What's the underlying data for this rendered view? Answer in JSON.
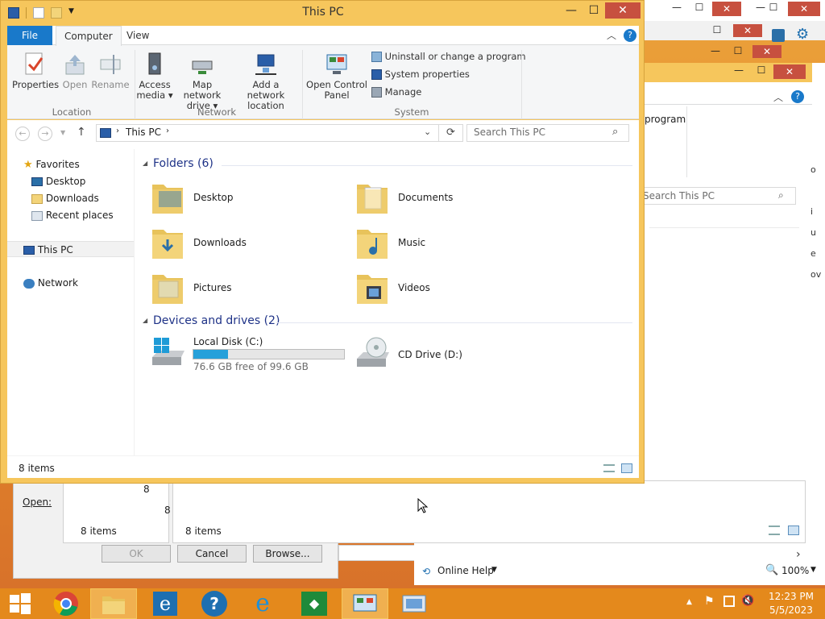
{
  "main_window": {
    "title": "This PC",
    "tabs": {
      "file": "File",
      "computer": "Computer",
      "view": "View"
    },
    "ribbon": {
      "location": {
        "group": "Location",
        "properties": "Properties",
        "open": "Open",
        "rename": "Rename"
      },
      "network": {
        "group": "Network",
        "access_media_1": "Access",
        "access_media_2": "media",
        "map_drive_1": "Map network",
        "map_drive_2": "drive",
        "add_location_1": "Add a network",
        "add_location_2": "location"
      },
      "system": {
        "group": "System",
        "control_panel_1": "Open Control",
        "control_panel_2": "Panel",
        "uninstall": "Uninstall or change a program",
        "sys_props": "System properties",
        "manage": "Manage"
      }
    },
    "address": {
      "path": "This PC",
      "search_placeholder": "Search This PC"
    },
    "nav": {
      "favorites": "Favorites",
      "desktop": "Desktop",
      "downloads": "Downloads",
      "recent": "Recent places",
      "this_pc": "This PC",
      "network": "Network"
    },
    "folders_header": "Folders (6)",
    "folders": {
      "desktop": "Desktop",
      "documents": "Documents",
      "downloads": "Downloads",
      "music": "Music",
      "pictures": "Pictures",
      "videos": "Videos"
    },
    "drives_header": "Devices and drives (2)",
    "drives": {
      "c_name": "Local Disk (C:)",
      "c_free": "76.6 GB free of 99.6 GB",
      "c_used_fraction": 0.23,
      "d_name": "CD Drive (D:)"
    },
    "status": "8 items"
  },
  "background": {
    "program_text": "program",
    "search_placeholder": "Search This PC",
    "status_left": "8 items",
    "status_right": "8 items",
    "open_label": "Open:",
    "ok": "OK",
    "cancel": "Cancel",
    "browse": "Browse...",
    "online_help": "Online Help",
    "zoom": "100%",
    "partial_8": "8"
  },
  "taskbar": {
    "time": "12:23 PM",
    "date": "5/5/2023"
  },
  "colors": {
    "accent": "#1979ca",
    "titlebar": "#f6c65c",
    "taskbar": "#e4891c",
    "close": "#c7503f"
  }
}
